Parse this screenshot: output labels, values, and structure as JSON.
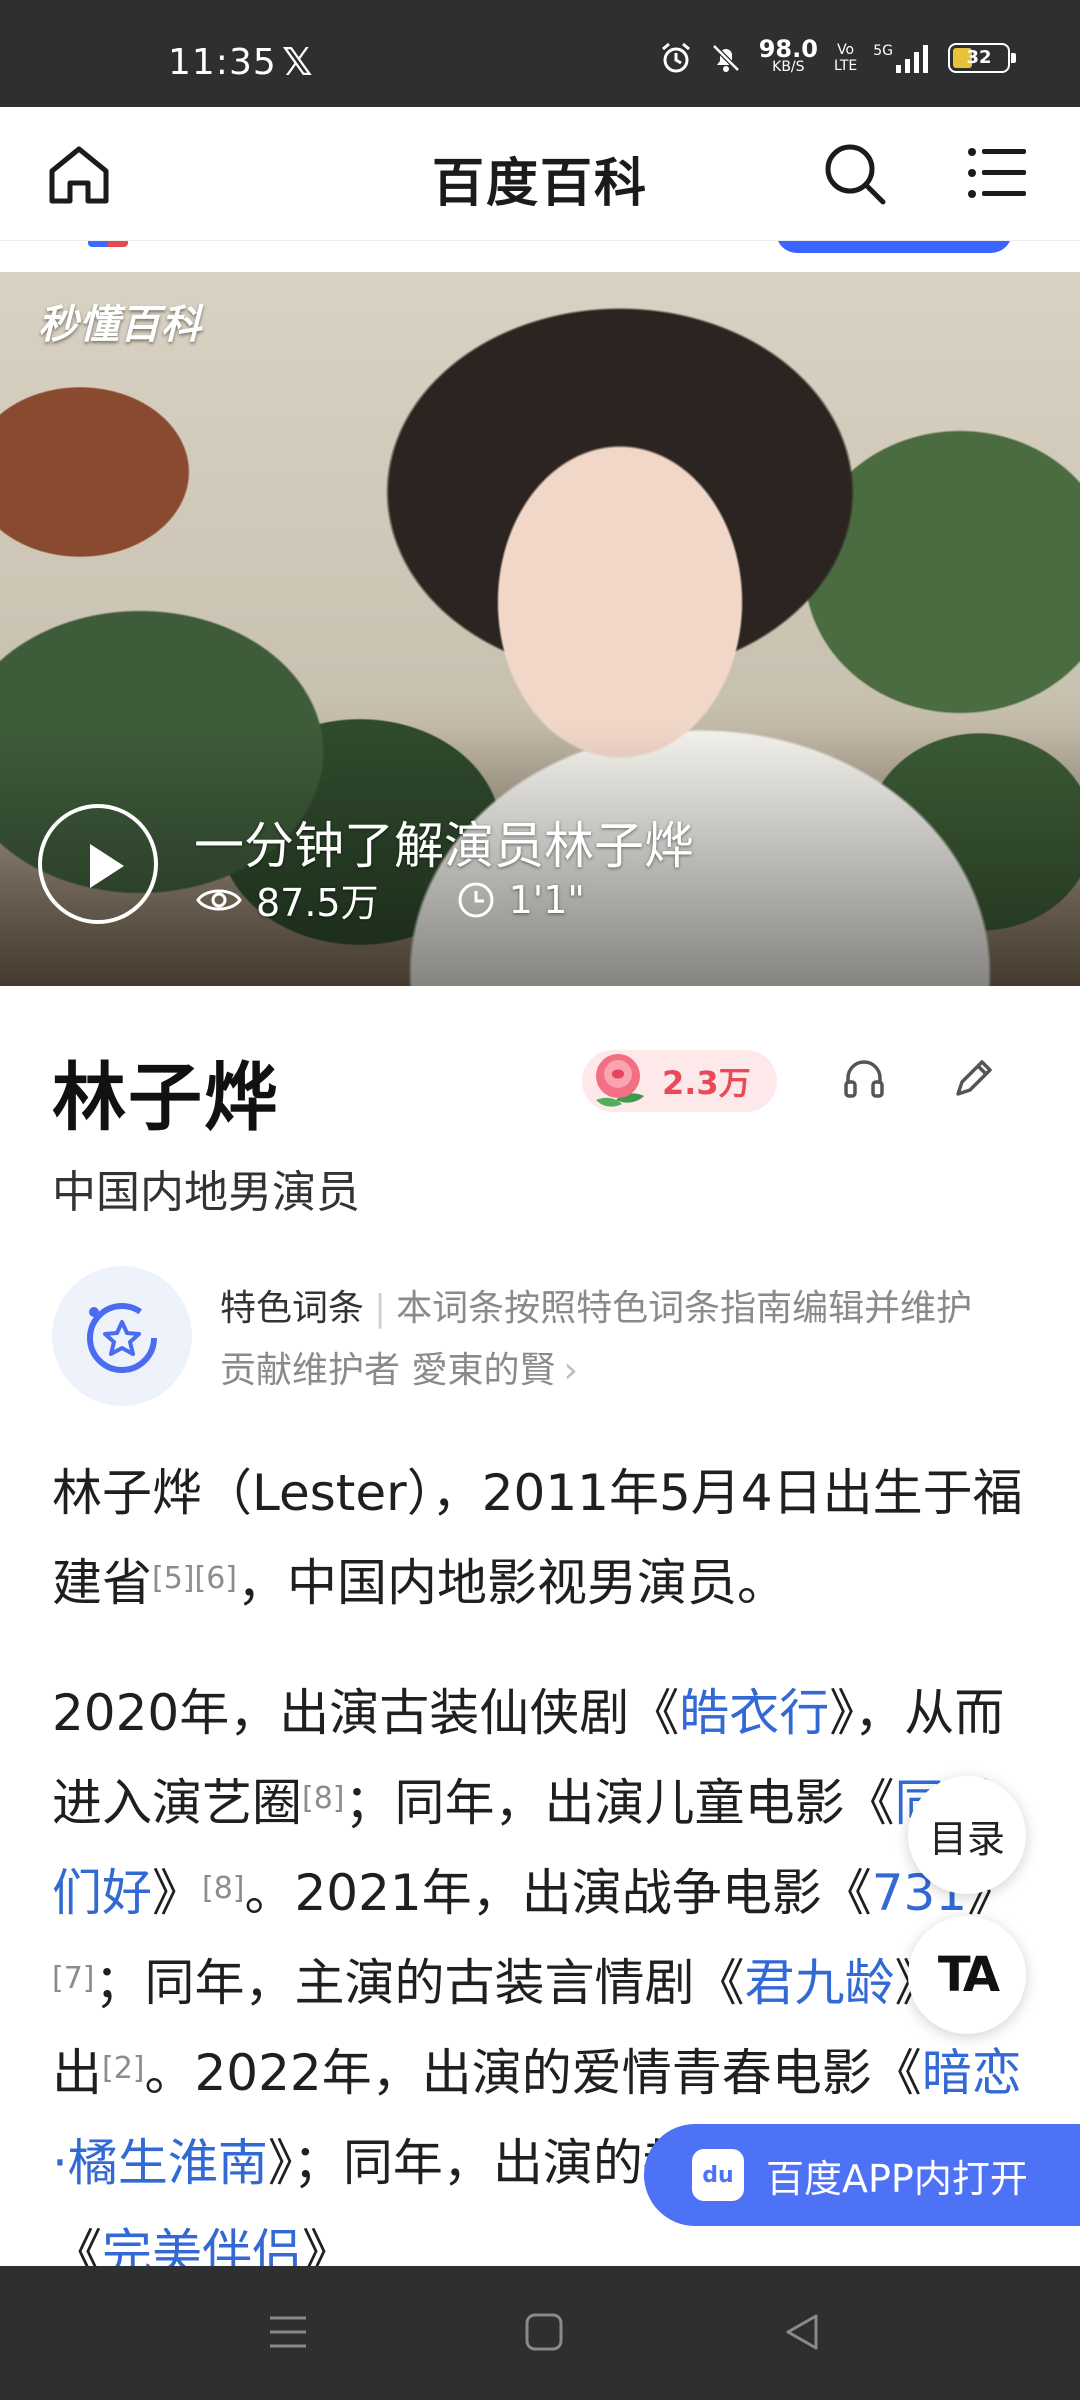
{
  "status_bar": {
    "time": "11:35",
    "app_icon": "x-logo-icon",
    "net_speed_value": "98.0",
    "net_speed_unit": "KB/S",
    "volte": "Vo\nLTE",
    "network": "5G",
    "battery": "32"
  },
  "header": {
    "title": "百度百科",
    "icons": [
      "home-icon",
      "search-icon",
      "menu-icon"
    ]
  },
  "video": {
    "watermark": "秒懂百科",
    "title": "一分钟了解演员林子烨",
    "views": "87.5万",
    "duration": "1'1\""
  },
  "entry": {
    "name": "林子烨",
    "likes": "2.3万",
    "subtitle": "中国内地男演员"
  },
  "feature": {
    "tag": "特色词条",
    "description": "本词条按照特色词条指南编辑并维护",
    "contributor": "贡献维护者 愛東的賢"
  },
  "paragraph1": {
    "t1": "林子烨（Lester），2011年5月4日出生于福建省",
    "ref1": "[5][6]",
    "t2": "，中国内地影视男演员。"
  },
  "paragraph2": {
    "t1": "2020年，出演古装仙侠剧《",
    "l1": "皓衣行",
    "t2": "》，从而进入演艺圈",
    "r1": "[8]",
    "t3": "；同年，出演儿童电影《",
    "l2": "同学们好",
    "t4": "》",
    "r2": "[8]",
    "t5": "。2021年，出演战争电影《",
    "l3": "731",
    "t6": "》",
    "r3": "[7]",
    "t7": "；同年，主演的古装言情剧《",
    "l4": "君九龄",
    "t8": "》播出",
    "r4": "[2]",
    "t9": "。2022年，出演的爱情青春电影《",
    "l5": "暗恋·橘生淮南",
    "t10": "》；同年，出演的都市家庭情感剧《",
    "l6": "完美伴侣",
    "t11": "》"
  },
  "floating": {
    "toc": "目录",
    "font": "TA",
    "open_app": "百度APP内打开"
  },
  "colors": {
    "link": "#3269d4",
    "accent_blue": "#4e72f5",
    "likes_red": "#e94a5a",
    "status_bg": "#2e2f31"
  }
}
